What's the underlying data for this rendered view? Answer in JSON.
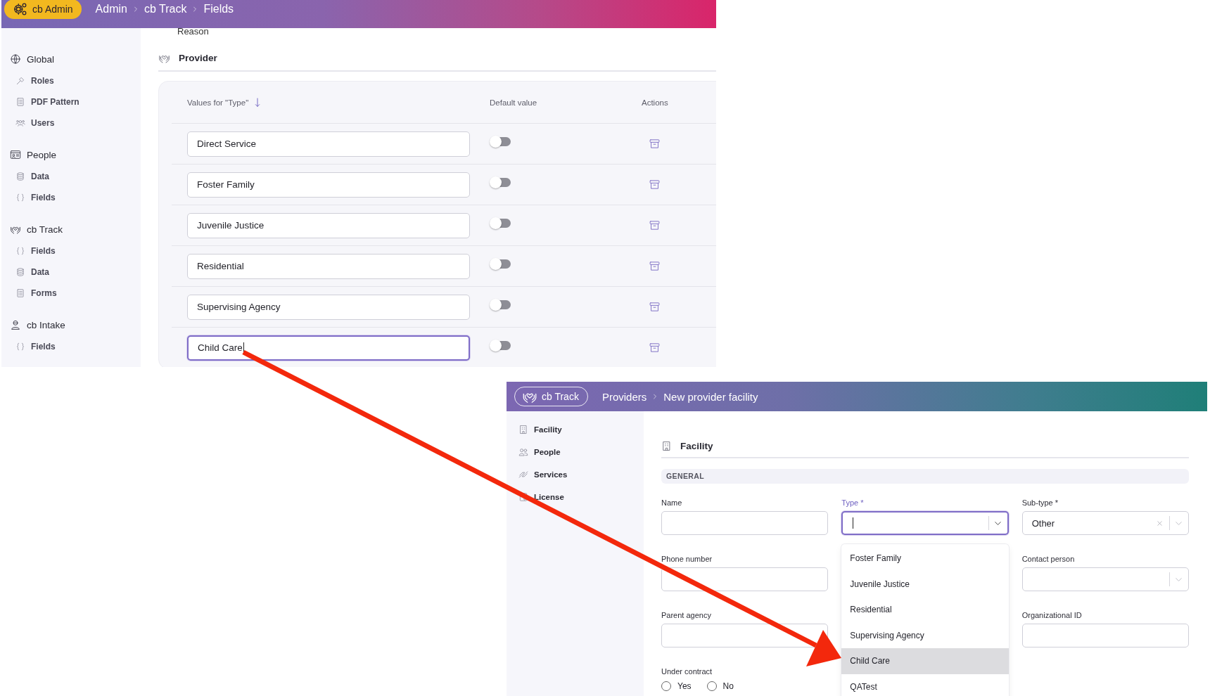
{
  "admin_panel": {
    "header": {
      "badge": "cb Admin",
      "breadcrumb": [
        "Admin",
        "cb Track",
        "Fields"
      ]
    },
    "sidebar": [
      {
        "label": "Global",
        "items": [
          "Roles",
          "PDF Pattern",
          "Users"
        ]
      },
      {
        "label": "People",
        "items": [
          "Data",
          "Fields"
        ]
      },
      {
        "label": "cb Track",
        "items": [
          "Fields",
          "Data",
          "Forms"
        ]
      },
      {
        "label": "cb Intake",
        "items": [
          "Fields"
        ]
      }
    ],
    "previous_field": "Reason",
    "section_title": "Provider",
    "table": {
      "columns": [
        "Values for \"Type\"",
        "Default value",
        "Actions"
      ],
      "rows": [
        {
          "value": "Direct Service",
          "default_on": false,
          "focused": false
        },
        {
          "value": "Foster Family",
          "default_on": false,
          "focused": false
        },
        {
          "value": "Juvenile Justice",
          "default_on": false,
          "focused": false
        },
        {
          "value": "Residential",
          "default_on": false,
          "focused": false
        },
        {
          "value": "Supervising Agency",
          "default_on": false,
          "focused": false
        },
        {
          "value": "Child Care",
          "default_on": false,
          "focused": true
        }
      ]
    }
  },
  "provider_panel": {
    "header": {
      "badge": "cb Track",
      "breadcrumb": [
        "Providers",
        "New provider facility"
      ]
    },
    "sidebar": [
      "Facility",
      "People",
      "Services",
      "License"
    ],
    "section_title": "Facility",
    "group_title": "GENERAL",
    "fields": [
      {
        "kind": "text",
        "label": "Name",
        "focused": false
      },
      {
        "kind": "select",
        "label": "Type *",
        "focused": true,
        "options": [
          {
            "label": "Foster Family",
            "selected": false
          },
          {
            "label": "Juvenile Justice",
            "selected": false
          },
          {
            "label": "Residential",
            "selected": false
          },
          {
            "label": "Supervising Agency",
            "selected": false
          },
          {
            "label": "Child Care",
            "selected": true
          },
          {
            "label": "QATest",
            "selected": false
          }
        ]
      },
      {
        "kind": "select",
        "label": "Sub-type *",
        "value": "Other",
        "clearable": true,
        "focused": false
      },
      {
        "kind": "text",
        "label": "Phone number",
        "focused": false
      },
      {
        "kind": "select",
        "label": "Contact person",
        "focused": false
      },
      {
        "kind": "text",
        "label": "Parent agency",
        "focused": false
      },
      {
        "kind": "text",
        "label": "Organizational ID",
        "focused": false
      },
      {
        "kind": "radio",
        "label": "Under contract",
        "options": [
          {
            "label": "Yes",
            "selected": false
          },
          {
            "label": "No",
            "selected": false
          }
        ]
      }
    ]
  }
}
